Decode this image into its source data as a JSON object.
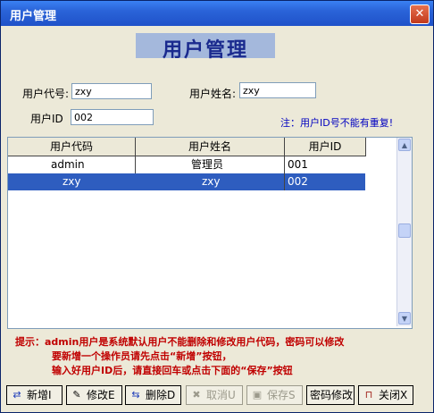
{
  "window": {
    "title": "用户管理",
    "close_glyph": "✕"
  },
  "banner": "用户管理",
  "form": {
    "code_label": "用户代号:",
    "code_value": "zxy",
    "name_label": "用户姓名:",
    "name_value": "zxy",
    "id_label": "用户ID",
    "id_value": "002",
    "note": "注：用户ID号不能有重复!"
  },
  "grid": {
    "headers": [
      "用户代码",
      "用户姓名",
      "用户ID"
    ],
    "rows": [
      {
        "code": "admin",
        "name": "管理员",
        "id": "001",
        "selected": false
      },
      {
        "code": "zxy",
        "name": "zxy",
        "id": "002",
        "selected": true
      }
    ]
  },
  "tips": {
    "line1": "提示：admin用户是系统默认用户不能删除和修改用户代码，密码可以修改",
    "line2": "要新增一个操作员请先点击“新增”按钮，",
    "line3": "输入好用户ID后，请直接回车或点击下面的“保存”按钮"
  },
  "toolbar": {
    "add": "新增I",
    "edit": "修改E",
    "delete": "删除D",
    "cancel": "取消U",
    "save": "保存S",
    "password": "密码修改",
    "close": "关闭X"
  },
  "icons": [
    "add-icon",
    "edit-icon",
    "delete-icon",
    "cancel-icon",
    "save-icon",
    "close-door-icon"
  ],
  "colors": {
    "selection": "#2e5dbf",
    "note": "#0000c0",
    "tip": "#c00000",
    "titlebar": "#2a63d8"
  }
}
